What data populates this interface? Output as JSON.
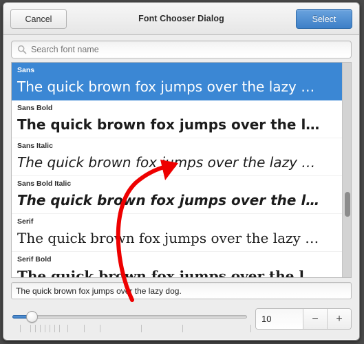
{
  "window": {
    "title": "Font Chooser Dialog"
  },
  "header": {
    "cancel_label": "Cancel",
    "select_label": "Select",
    "accent_color": "#3d7fc7"
  },
  "search": {
    "icon": "search-icon",
    "placeholder": "Search font name",
    "value": ""
  },
  "font_list": {
    "selected_index": 0,
    "selection_color": "#3b87d4",
    "sample_text": "The quick brown fox jumps over the lazy dog.",
    "rows": [
      {
        "name": "Sans",
        "sample": "The quick brown fox jumps over the lazy …"
      },
      {
        "name": "Sans Bold",
        "sample": "The quick brown fox jumps over the l…"
      },
      {
        "name": "Sans Italic",
        "sample": "The quick brown fox jumps over the lazy …"
      },
      {
        "name": "Sans Bold Italic",
        "sample": "The quick brown fox jumps over the l…"
      },
      {
        "name": "Serif",
        "sample": "The quick brown fox jumps over the lazy …"
      },
      {
        "name": "Serif Bold",
        "sample": "The quick brown fox jumps over the l…"
      }
    ]
  },
  "preview": {
    "text": "The quick brown fox jumps over the lazy dog."
  },
  "size": {
    "value": "10",
    "minus_label": "−",
    "plus_label": "+",
    "slider_position_percent": 6
  },
  "annotation": {
    "color": "#ee0000",
    "shape": "curved-arrow"
  }
}
